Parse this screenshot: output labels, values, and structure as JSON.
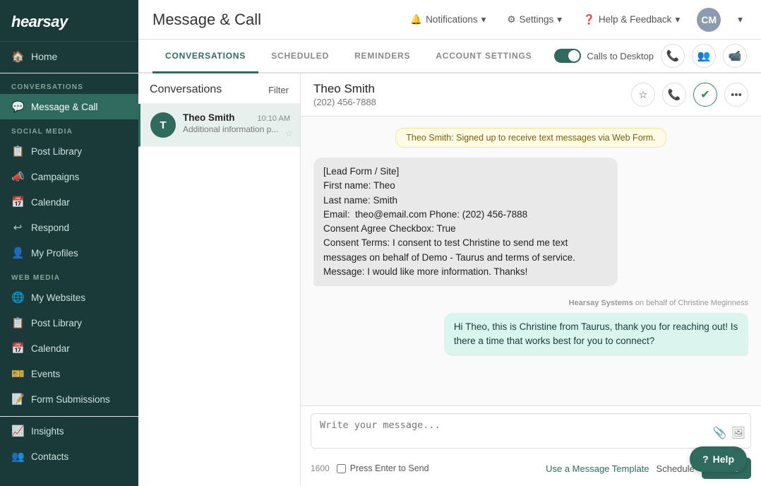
{
  "sidebar": {
    "logo": "hearsay",
    "home_label": "Home",
    "conversations_section": "CONVERSATIONS",
    "message_call_label": "Message & Call",
    "social_media_section": "SOCIAL MEDIA",
    "social_items": [
      {
        "label": "Post Library",
        "icon": "📋"
      },
      {
        "label": "Campaigns",
        "icon": "📣"
      },
      {
        "label": "Calendar",
        "icon": "📅"
      },
      {
        "label": "Respond",
        "icon": "↩"
      },
      {
        "label": "My Profiles",
        "icon": "👤"
      }
    ],
    "web_media_section": "WEB MEDIA",
    "web_items": [
      {
        "label": "My Websites",
        "icon": "🌐"
      },
      {
        "label": "Post Library",
        "icon": "📋"
      },
      {
        "label": "Calendar",
        "icon": "📅"
      },
      {
        "label": "Events",
        "icon": "🎫"
      },
      {
        "label": "Form Submissions",
        "icon": "📝"
      }
    ],
    "insights_label": "Insights",
    "contacts_label": "Contacts"
  },
  "topbar": {
    "page_title": "Message & Call",
    "notifications_label": "Notifications",
    "settings_label": "Settings",
    "help_label": "Help & Feedback",
    "avatar_initials": "CM"
  },
  "tabs": {
    "items": [
      {
        "label": "CONVERSATIONS",
        "active": true
      },
      {
        "label": "SCHEDULED",
        "active": false
      },
      {
        "label": "REMINDERS",
        "active": false
      },
      {
        "label": "ACCOUNT SETTINGS",
        "active": false
      }
    ],
    "calls_to_desktop": "Calls to Desktop",
    "toggle_on": true
  },
  "conversations": {
    "header": "Conversations",
    "filter_label": "Filter",
    "items": [
      {
        "name": "Theo Smith",
        "time": "10:10 AM",
        "preview": "Additional information p...",
        "avatar": "T",
        "selected": true
      }
    ]
  },
  "chat": {
    "contact_name": "Theo Smith",
    "contact_phone": "(202) 456-7888",
    "system_msg": "Theo Smith: Signed up to receive text messages via Web Form.",
    "messages": [
      {
        "type": "received",
        "content": "[Lead Form / Site]\nFirst name: Theo\nLast name: Smith\nEmail:  theo@email.com Phone: (202) 456-7888\nConsent Agree Checkbox: True\nConsent Terms: I consent to test Christine to send me text messages on behalf of Demo - Taurus and terms of service.\nMessage: I would like more information. Thanks!",
        "sender": null
      },
      {
        "type": "sent",
        "content": "Hi Theo, this is Christine from Taurus, thank you for reaching out! Is there a time that works best for you to connect?",
        "sender": "Hearsay Systems",
        "sender_suffix": " on behalf of Christine Meginness"
      }
    ],
    "compose_placeholder": "Write your message...",
    "char_count": "1600",
    "press_enter_label": "Press Enter to Send",
    "template_label": "Use a Message Template",
    "schedule_label": "Schedule",
    "send_label": "Send"
  },
  "help_fab": "Help"
}
